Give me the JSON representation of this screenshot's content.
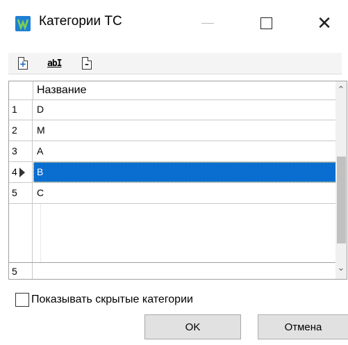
{
  "window": {
    "title": "Категории ТС",
    "controls": {
      "minimize": "—",
      "maximize": "☐",
      "close": "✕"
    }
  },
  "toolbar": {
    "add_icon": "add-document-icon",
    "rename_icon": "rename-text-icon",
    "rename_glyph": "abI",
    "delete_icon": "delete-document-icon"
  },
  "grid": {
    "column_header": "Название",
    "rows": [
      {
        "num": "1",
        "name": "D",
        "selected": false
      },
      {
        "num": "2",
        "name": "M",
        "selected": false
      },
      {
        "num": "3",
        "name": "A",
        "selected": false
      },
      {
        "num": "4",
        "name": "B",
        "selected": true
      },
      {
        "num": "5",
        "name": "C",
        "selected": false
      }
    ],
    "footer_count": "5"
  },
  "options": {
    "show_hidden_label": "Показывать скрытые категории",
    "show_hidden_checked": false
  },
  "buttons": {
    "ok_label": "OK",
    "cancel_label": "Отмена"
  },
  "colors": {
    "selection": "#0a6ed1",
    "app_icon": "#1f7fd4"
  }
}
